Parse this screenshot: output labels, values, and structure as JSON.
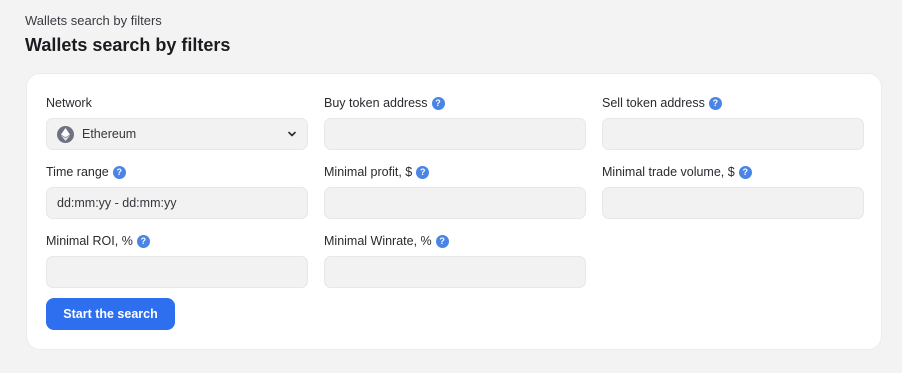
{
  "header": {
    "breadcrumb": "Wallets search by filters",
    "title": "Wallets search by filters"
  },
  "form": {
    "network": {
      "label": "Network",
      "value": "Ethereum",
      "icon": "ethereum-icon"
    },
    "buy_token": {
      "label": "Buy token address",
      "placeholder": "",
      "value": ""
    },
    "sell_token": {
      "label": "Sell token address",
      "placeholder": "",
      "value": ""
    },
    "time_range": {
      "label": "Time range",
      "value": "dd:mm:yy - dd:mm:yy"
    },
    "min_profit": {
      "label": "Minimal profit, $",
      "value": ""
    },
    "min_trade_volume": {
      "label": "Minimal trade volume, $",
      "value": ""
    },
    "min_roi": {
      "label": "Minimal ROI, %",
      "value": ""
    },
    "min_winrate": {
      "label": "Minimal Winrate, %",
      "value": ""
    },
    "help_glyph": "?",
    "submit_label": "Start the search"
  },
  "colors": {
    "accent": "#2e6ff0",
    "help_icon": "#4a84e6",
    "input_bg": "#f2f2f3",
    "page_bg": "#f3f3f4"
  }
}
